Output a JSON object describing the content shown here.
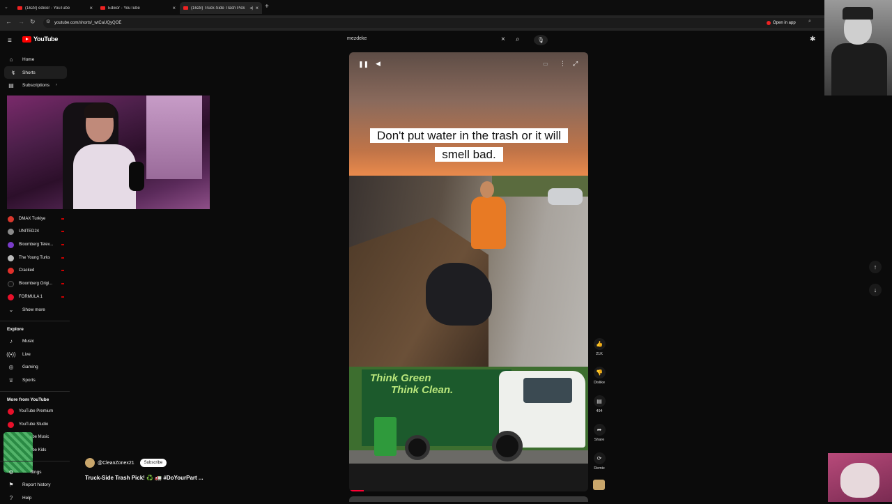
{
  "browser": {
    "tabs": [
      {
        "title": "(1628) edixor - YouTube"
      },
      {
        "title": "Edixor - YouTube"
      },
      {
        "title": "(1628) Truck-Side Trash Pick"
      }
    ],
    "url": "youtube.com/shorts/_wtCaUQyQOE",
    "open_in_app": "Open in app"
  },
  "header": {
    "logo": "YouTube",
    "search_value": "mezdeke"
  },
  "sidebar": {
    "nav": [
      {
        "label": "Home",
        "icon": "home-icon"
      },
      {
        "label": "Shorts",
        "icon": "shorts-icon"
      },
      {
        "label": "Subscriptions",
        "icon": "subscriptions-icon"
      }
    ],
    "channels": [
      {
        "label": "DMAX Turkiye",
        "color": "#d8372c"
      },
      {
        "label": "UNITED24",
        "color": "#8a8a8a"
      },
      {
        "label": "Bloomberg Telev...",
        "color": "#7a3cc9"
      },
      {
        "label": "The Young Turks",
        "color": "#bbbbbb"
      },
      {
        "label": "Cracked",
        "color": "#e0302a"
      },
      {
        "label": "Bloomberg Origi...",
        "color": "#111111"
      },
      {
        "label": "FORMULA 1",
        "color": "#e8102a"
      }
    ],
    "show_more": "Show more",
    "explore_title": "Explore",
    "explore": [
      {
        "label": "Music",
        "icon": "music-icon"
      },
      {
        "label": "Live",
        "icon": "live-icon"
      },
      {
        "label": "Gaming",
        "icon": "gaming-icon"
      },
      {
        "label": "Sports",
        "icon": "trophy-icon"
      }
    ],
    "more_title": "More from YouTube",
    "more": [
      {
        "label": "YouTube Premium",
        "color": "#e8102a"
      },
      {
        "label": "YouTube Studio",
        "color": "#e8102a"
      },
      {
        "label": "ube Music",
        "color": "#e8102a"
      },
      {
        "label": "ube Kids",
        "color": "#e8102a"
      }
    ],
    "bottom": [
      {
        "label": "ttings",
        "icon": "settings-icon"
      },
      {
        "label": "Report history",
        "icon": "flag-icon"
      },
      {
        "label": "Help",
        "icon": "help-icon"
      }
    ]
  },
  "short": {
    "caption": "Don't put water in the trash or it will smell bad.",
    "truck_text_1": "Think Green",
    "truck_text_2": "Think Clean.",
    "progress": 0.06
  },
  "actions": {
    "like_count": "21K",
    "dislike_label": "Dislike",
    "comments_count": "494",
    "share_label": "Share",
    "remix_label": "Remix"
  },
  "channel": {
    "handle": "@CleanZonex21",
    "subscribe_label": "Subscribe",
    "video_title": "Truck-Side Trash Pick! ♻️ 🚛 #DoYourPart ..."
  }
}
